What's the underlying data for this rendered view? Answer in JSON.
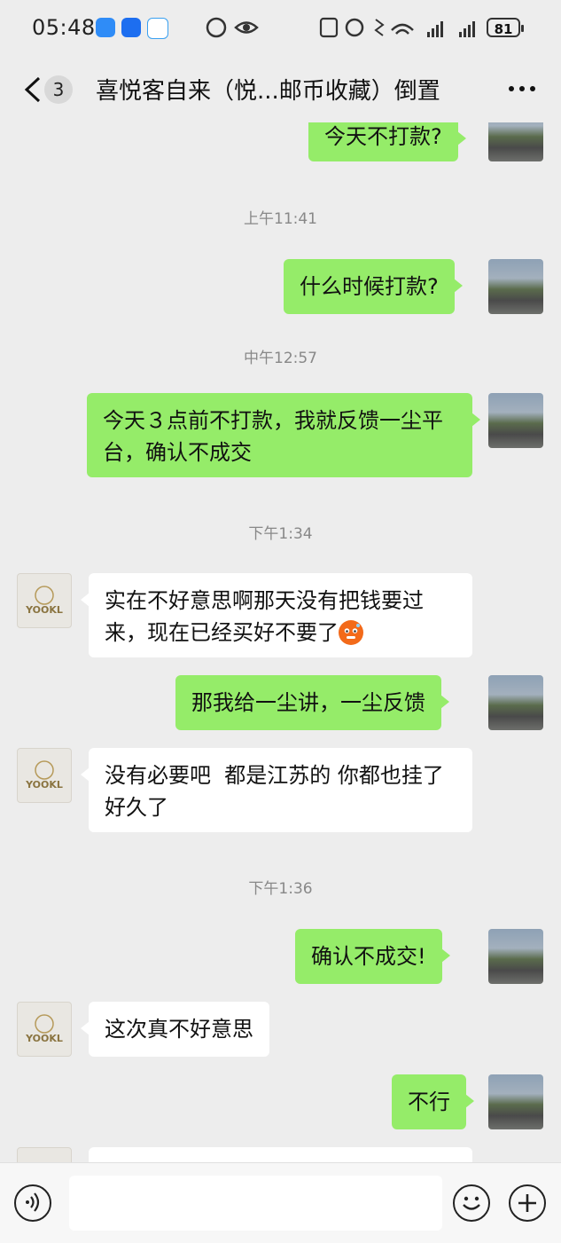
{
  "status_bar": {
    "time": "05:48",
    "battery": "81"
  },
  "header": {
    "unread_count": "3",
    "title": "喜悦客自来（悦...邮币收藏）倒置"
  },
  "messages": [
    {
      "type": "me",
      "text": "今天不打款?"
    },
    {
      "type": "time",
      "text": "上午11:41"
    },
    {
      "type": "me",
      "text": "什么时候打款?"
    },
    {
      "type": "time",
      "text": "中午12:57"
    },
    {
      "type": "me",
      "text": "今天３点前不打款，我就反馈一尘平台，确认不成交"
    },
    {
      "type": "time",
      "text": "下午1:34"
    },
    {
      "type": "other",
      "text": "实在不好意思啊那天没有把钱要过来，现在已经买好不要了"
    },
    {
      "type": "me",
      "text": "那我给一尘讲，一尘反馈"
    },
    {
      "type": "other",
      "text": "没有必要吧  都是江苏的 你都也挂了好久了"
    },
    {
      "type": "time",
      "text": "下午1:36"
    },
    {
      "type": "me",
      "text": "确认不成交!"
    },
    {
      "type": "other",
      "text": "这次真不好意思"
    },
    {
      "type": "me",
      "text": "不行"
    }
  ],
  "avatar": {
    "other_logo_text": "YOOKL"
  },
  "icons": {
    "back": "chevron-left-icon",
    "more": "more-horizontal-icon",
    "voice": "voice-icon",
    "emoji": "emoji-icon",
    "plus": "plus-icon",
    "emoji_in_message": "cold-face-emoji"
  },
  "colors": {
    "my_bubble": "#95ec69",
    "other_bubble": "#ffffff",
    "background": "#ededed"
  }
}
